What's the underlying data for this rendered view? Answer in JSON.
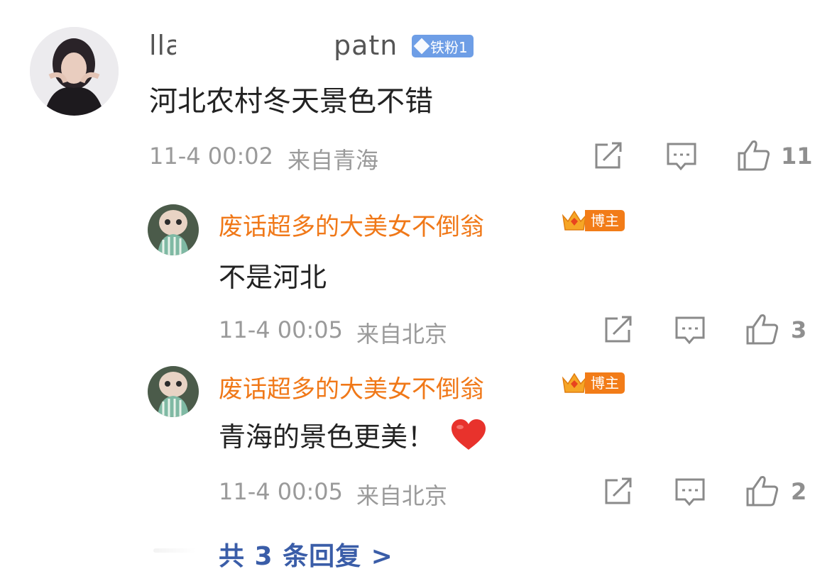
{
  "comment": {
    "username": "lla",
    "username_tail": "patn",
    "fan_badge": "铁粉1",
    "text": "河北农村冬天景色不错",
    "time": "11-4 00:02",
    "location": "来自青海",
    "likes": "11"
  },
  "replies": [
    {
      "name": "废话超多的大美女不倒翁",
      "badge": "博主",
      "text": "不是河北",
      "emoji": "",
      "time": "11-4 00:05",
      "location": "来自北京",
      "likes": "3"
    },
    {
      "name": "废话超多的大美女不倒翁",
      "badge": "博主",
      "text": "青海的景色更美！",
      "emoji": "❤️",
      "time": "11-4 00:05",
      "location": "来自北京",
      "likes": "2"
    }
  ],
  "footer": {
    "total_replies": "共 3 条回复 >"
  },
  "colors": {
    "orange_name": "#f07818",
    "meta_gray": "#9a9a9a",
    "link_blue": "#3a5da8",
    "fan_badge_blue": "#6e9ee6"
  },
  "icons": [
    "share-icon",
    "comment-icon",
    "like-icon",
    "heart-emoji-icon",
    "crown-icon",
    "diamond-icon"
  ]
}
